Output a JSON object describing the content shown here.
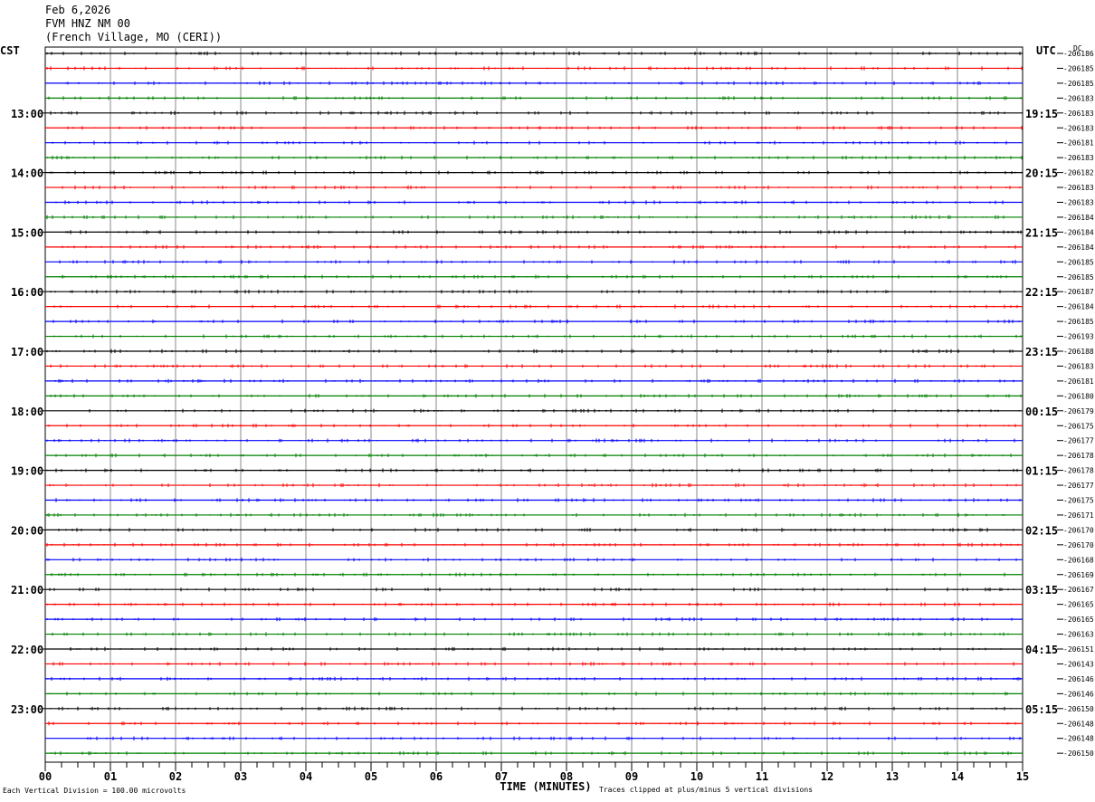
{
  "header": {
    "date": "Feb 6,2026",
    "station": "FVM HNZ NM 00",
    "location": "(French Village, MO (CERI))"
  },
  "axes": {
    "left_tz": "CST",
    "right_tz": "UTC",
    "dc_label": "DC",
    "xlabel": "TIME (MINUTES)"
  },
  "footer": {
    "scale_note": "Each Vertical Division =  100.00 microvolts",
    "clip_note": "Traces clipped at plus/minus 5 vertical divisions"
  },
  "colors": {
    "trace_cycle": [
      "#000000",
      "#ff0000",
      "#0000ff",
      "#008000"
    ],
    "grid": "#8a8a8a"
  },
  "chart_data": {
    "type": "line",
    "title": "FVM HNZ NM 00",
    "xlabel": "TIME (MINUTES)",
    "x_ticks": [
      "00",
      "01",
      "02",
      "03",
      "04",
      "05",
      "06",
      "07",
      "08",
      "09",
      "10",
      "11",
      "12",
      "13",
      "14",
      "15"
    ],
    "xlim": [
      0,
      15
    ],
    "grid": true,
    "left_hour_labels": [
      "13:00",
      "14:00",
      "15:00",
      "16:00",
      "17:00",
      "18:00",
      "19:00",
      "20:00",
      "21:00",
      "22:00",
      "23:00"
    ],
    "right_hour_labels": [
      "19:15",
      "20:15",
      "21:15",
      "22:15",
      "23:15",
      "00:15",
      "01:15",
      "02:15",
      "03:15",
      "04:15",
      "05:15"
    ],
    "dc_offsets": [
      "-206186",
      "-206185",
      "-206185",
      "-206183",
      "-206183",
      "-206183",
      "-206181",
      "-206183",
      "-206182",
      "-206183",
      "-206183",
      "-206184",
      "-206184",
      "-206184",
      "-206185",
      "-206185",
      "-206187",
      "-206184",
      "-206185",
      "-206193",
      "-206188",
      "-206183",
      "-206181",
      "-206180",
      "-206179",
      "-206175",
      "-206177",
      "-206178",
      "-206178",
      "-206177",
      "-206175",
      "-206171",
      "-206170",
      "-206170",
      "-206168",
      "-206169",
      "-206167",
      "-206165",
      "-206165",
      "-206163",
      "-206151",
      "-206143",
      "-206146",
      "-206146",
      "-206150",
      "-206148",
      "-206148",
      "-206150"
    ]
  }
}
